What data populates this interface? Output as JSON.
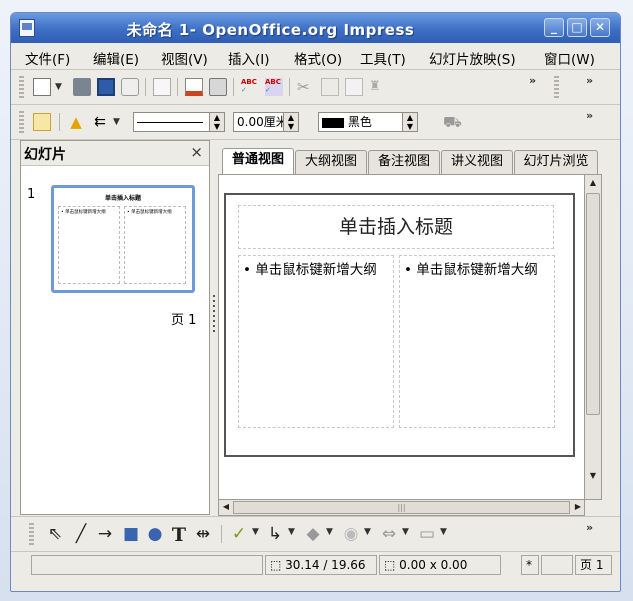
{
  "window": {
    "title": "未命名 1- OpenOffice.org Impress",
    "minimize_label": "_",
    "maximize_label": "□",
    "close_label": "✕"
  },
  "menubar": {
    "items": [
      {
        "label": "文件(F)"
      },
      {
        "label": "编辑(E)"
      },
      {
        "label": "视图(V)"
      },
      {
        "label": "插入(I)"
      },
      {
        "label": "格式(O)"
      },
      {
        "label": "工具(T)"
      },
      {
        "label": "幻灯片放映(S)"
      },
      {
        "label": "窗口(W)"
      }
    ]
  },
  "format_toolbar": {
    "line_width_value": "0.00厘米",
    "line_color_value": "黑色",
    "line_color_swatch": "#000000"
  },
  "slides_pane": {
    "title": "幻灯片",
    "close_label": "×",
    "slide_number": "1",
    "page_label": "页 1",
    "thumb_title": "单击插入标题",
    "thumb_left": "• 单击鼠标键新增大纲",
    "thumb_right": "• 单击鼠标键新增大纲"
  },
  "view_tabs": [
    {
      "label": "普通视图"
    },
    {
      "label": "大纲视图"
    },
    {
      "label": "备注视图"
    },
    {
      "label": "讲义视图"
    },
    {
      "label": "幻灯片浏览"
    }
  ],
  "slide": {
    "title_placeholder": "单击插入标题",
    "left_outline": "• 单击鼠标键新增大纲",
    "right_outline": "• 单击鼠标键新增大纲"
  },
  "drawing_toolbar": {
    "text_tool_label": "T"
  },
  "statusbar": {
    "position": "30.14 / 19.66",
    "size": "0.00 x 0.00",
    "modified": "*",
    "page": "页 1"
  },
  "colors": {
    "titlebar": "#3d6fc4",
    "accent_border": "#6d9bd6"
  }
}
